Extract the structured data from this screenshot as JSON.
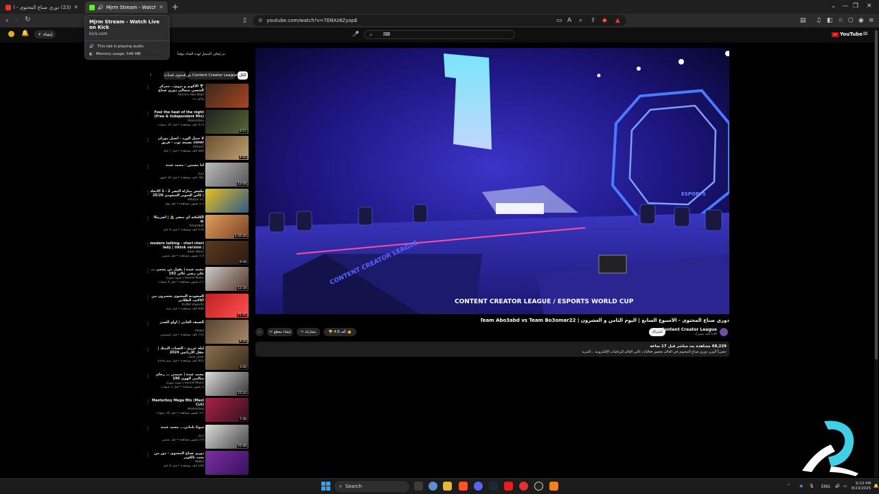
{
  "browser": {
    "tabs": [
      {
        "title": "(23) دوري صناع المحتوى - الأسبو",
        "active": false,
        "favicon_color": "#ff2d2d"
      },
      {
        "title": "Mjrm Stream - Watch Live on Kick",
        "active": true,
        "favicon_color": "#53fc18"
      }
    ],
    "new_tab": "+",
    "window_controls": [
      "⌄",
      "—",
      "❐",
      "✕"
    ],
    "address": "youtube.com/watch?v=7ENXz6ZyopE",
    "hover_card": {
      "title": "Mjrm Stream - Watch Live on Kick",
      "domain": "kick.com",
      "audio_text": "This tab is playing audio",
      "memory_text": "Memory usage: 546 MB"
    }
  },
  "youtube": {
    "create_label": "إنشاء",
    "logo_text": "YouTube",
    "notice": "تم إيقاف السجل لهذه القناة مؤقتاً",
    "chips": [
      "الكل",
      "من Content Creator League",
      "مُحتوى مُحدّث"
    ],
    "video": {
      "title": "دوري صناع المحتوى - الأسبوع السابع | اليوم الثامن و العشرون | Team Abo3abd vs Team Bo3omar22",
      "channel": "Content Creator League",
      "subscribers": "149 ألف مشترك",
      "subscribe_label": "اشتراك",
      "likes": "4.9 ألف",
      "share_label": "مشاركة",
      "clip_label": "إنشاء مقطع",
      "more_label": "⋯",
      "views_line": "68,229 مشاهدة بث مباشر قبل 17 ساعة",
      "desc_line": "حصرياً الوزن دوري صناع المحتوى في العالم بحضور فعاليات كأس العالم للرياضات الإلكترونية ...المزيد"
    },
    "recommendations": [
      {
        "title": "🏆 الأكويز و نزوي.. ممركز الشعبي سجالي دوري صناع المحتوى...",
        "channel": "Falcons Abu Najd",
        "meta": "وثائق بث",
        "duration": "",
        "thumb": [
          "#3a2a1a",
          "#aa4422"
        ]
      },
      {
        "title": "Feel the heat of the night (Free & Independent Mix)",
        "channel": "Masterboy",
        "meta": "373 ألف مشاهدة • قبل 10 سنوات",
        "duration": "6:57",
        "thumb": [
          "#202020",
          "#556633"
        ]
      },
      {
        "title": "لا حبيل الورد - أصيل موزان cover بصيغة نوب - فريق أصيلك",
        "channel": "Umolar",
        "meta": "384 ألف مشاهدة • قبل 7 أيام",
        "duration": "4:02",
        "thumb": [
          "#6a5030",
          "#c0a070"
        ]
      },
      {
        "title": "لنا معيبين - محمد عبده",
        "channel": "ابزال",
        "meta": "785 ألف مشاهدة • قبل 10 أشهر",
        "duration": "12:04",
        "thumb": [
          "#bbbbbb",
          "#555555"
        ]
      },
      {
        "title": "ملخص مباراة النصر 2 - 1 الاتحاد | كأس السوبر السعودي 25/26 Al Nassr Vs",
        "channel": "AlNassr FC",
        "meta": "1.3 مليون مشاهدة • قبل يوم",
        "duration": "",
        "thumb": [
          "#e8c020",
          "#2a5a8a"
        ]
      },
      {
        "title": "الكلبكتة أي منصر 🧟 | اضربيكا 😂",
        "channel": "AlSalabat",
        "meta": "276 ألف مشاهدة • قبل 4 أيام",
        "duration": "1:32:20",
        "thumb": [
          "#e0a060",
          "#7a4020"
        ]
      },
      {
        "title": "modern talking - cheri cheri lady | tiktok version | (slowed + reverb)",
        "channel": "Slow Wave",
        "meta": "1.4 مليون مشاهدة • قبل سنتين",
        "duration": "6:44",
        "thumb": [
          "#5a3a20",
          "#2a1a10"
        ]
      },
      {
        "title": "محمد عبده | يقول من ينتمي ... علي رضي عالي 192",
        "channel": "Sound Music | سوند ميوزك",
        "meta": "2.1 مليون مشاهدة • قبل 6 سنوات",
        "duration": "12:34",
        "thumb": [
          "#cccccc",
          "#553322"
        ]
      },
      {
        "title": "السعودية المحتوى يخسرون من اكاكتب الطلابي",
        "channel": "POWR eSports",
        "meta": "646 ألف مشاهدة • قبل سنة",
        "duration": "21:25",
        "thumb": [
          "#c02020",
          "#ff5050"
        ]
      },
      {
        "title": "الصيف العابي | أولو الصدر",
        "channel": "Peaks",
        "meta": "735 ألف مشاهدة • قبل أسبوعين",
        "duration": "8:50",
        "thumb": [
          "#554433",
          "#aa8866"
        ]
      },
      {
        "title": "ليلة عرزي - الصياب البيتك | حفل الاربانس 2024",
        "channel": "حسان فيصل",
        "meta": "405 ألف مشاهدة • قبل سنة واحدة",
        "duration": "3:26",
        "thumb": [
          "#8a7050",
          "#3a2a1a"
        ]
      },
      {
        "title": "محمد عبده | حبيبتي ... رجاي سالمي الهوى 190",
        "channel": "Sound Music | سوند ميوزك",
        "meta": "2 مليون مشاهدة • قبل 5 سنوات",
        "duration": "15:22",
        "thumb": [
          "#dddddd",
          "#333333"
        ]
      },
      {
        "title": "Masterboy Mega Mix (Maxi Cut)",
        "channel": "Masterboy",
        "meta": "3.1 مليون مشاهدة • قبل 10 سنوات",
        "duration": "7:30",
        "thumb": [
          "#aa2244",
          "#331122"
        ]
      },
      {
        "title": "سوبًا ياماني... محمد عبده",
        "channel": "ابزال",
        "meta": "2.4 مليون مشاهدة • قبل سنتين",
        "duration": "25:46",
        "thumb": [
          "#dddddd",
          "#444444"
        ]
      },
      {
        "title": "دوري صناع المحتوى - دور من يحدد نالكوبر",
        "channel": "MAKS",
        "meta": "100 ألف مشاهدة • قبل 4 أيام",
        "duration": "",
        "thumb": [
          "#7a30a0",
          "#3a1060"
        ]
      }
    ]
  },
  "taskbar": {
    "search_label": "Search",
    "language": "ENG",
    "time": "9:23 PM",
    "date": "8/23/2025"
  },
  "colors": {
    "youtube_red": "#ff0000",
    "stage_blue": "#2a22a8",
    "watermark": "#3fd0e8"
  }
}
